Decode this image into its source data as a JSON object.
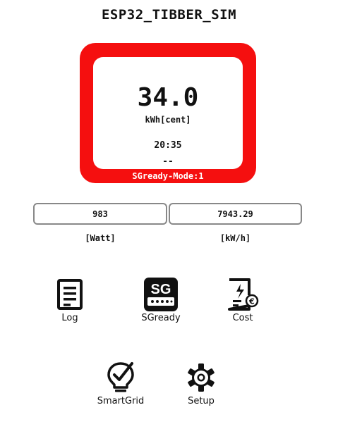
{
  "app": {
    "title": "ESP32_TIBBER_SIM"
  },
  "price": {
    "value": "34.0",
    "unit": "kWh[cent]",
    "time": "20:35",
    "extra": "--",
    "sg_mode": "SGready-Mode:1",
    "panel_color": "#f50f0f"
  },
  "metrics": {
    "power": {
      "value": "983",
      "label": "[Watt]"
    },
    "energy": {
      "value": "7943.29",
      "label": "[kW/h]"
    }
  },
  "nav": {
    "log": {
      "label": "Log",
      "icon": "document-lines-icon"
    },
    "sgready": {
      "label": "SGready",
      "icon": "sg-ready-icon",
      "icon_text": "SG"
    },
    "cost": {
      "label": "Cost",
      "icon": "bill-euro-icon",
      "badge_text": "€"
    },
    "smartgrid": {
      "label": "SmartGrid",
      "icon": "lightbulb-check-icon"
    },
    "setup": {
      "label": "Setup",
      "icon": "gear-icon"
    }
  }
}
